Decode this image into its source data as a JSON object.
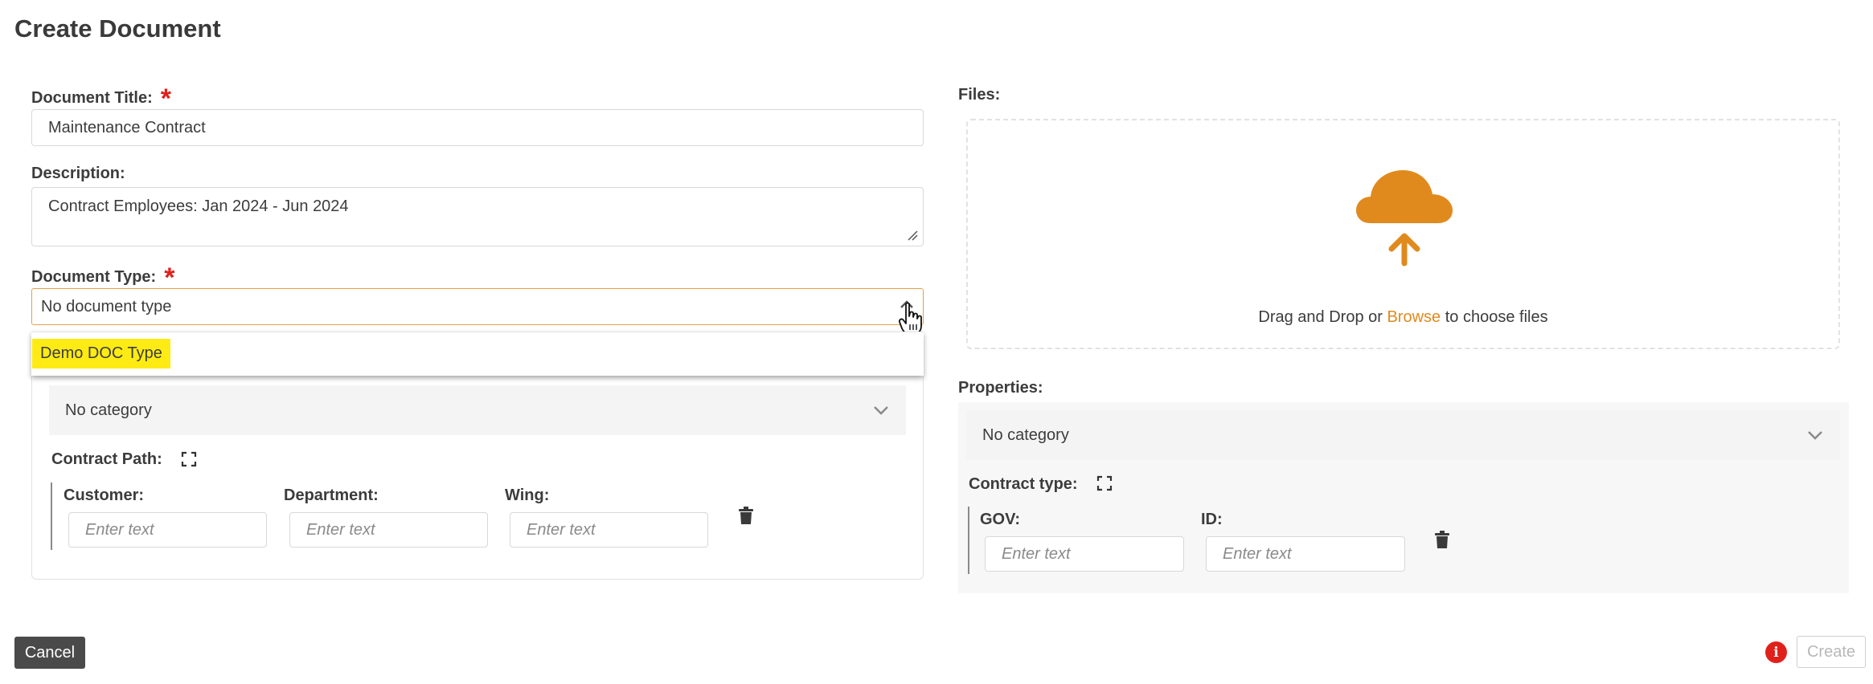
{
  "page": {
    "title": "Create Document"
  },
  "form": {
    "title_label": "Document Title:",
    "title_value": "Maintenance Contract",
    "required_mark": "*",
    "description_label": "Description:",
    "description_value": "Contract Employees: Jan 2024 - Jun 2024",
    "doctype_label": "Document Type:",
    "doctype_value": "No document type",
    "doctype_options": [
      "Demo DOC Type"
    ]
  },
  "left_panel": {
    "category_value": "No category",
    "group_label": "Contract Path:",
    "fields": [
      {
        "label": "Customer:",
        "placeholder": "Enter text"
      },
      {
        "label": "Department:",
        "placeholder": "Enter text"
      },
      {
        "label": "Wing:",
        "placeholder": "Enter text"
      }
    ]
  },
  "files": {
    "label": "Files:",
    "drop_prefix": "Drag and Drop or ",
    "browse_label": "Browse",
    "drop_suffix": " to choose files",
    "accent_color": "#e08a1e"
  },
  "properties": {
    "label": "Properties:",
    "category_value": "No category",
    "group_label": "Contract type:",
    "fields": [
      {
        "label": "GOV:",
        "placeholder": "Enter text"
      },
      {
        "label": "ID:",
        "placeholder": "Enter text"
      }
    ]
  },
  "footer": {
    "cancel_label": "Cancel",
    "create_label": "Create",
    "info_icon": "i"
  },
  "colors": {
    "required": "#e0211b",
    "highlight": "#ffeb14",
    "focus_border": "#e0a04a",
    "cancel_bg": "#4a4a4a"
  }
}
